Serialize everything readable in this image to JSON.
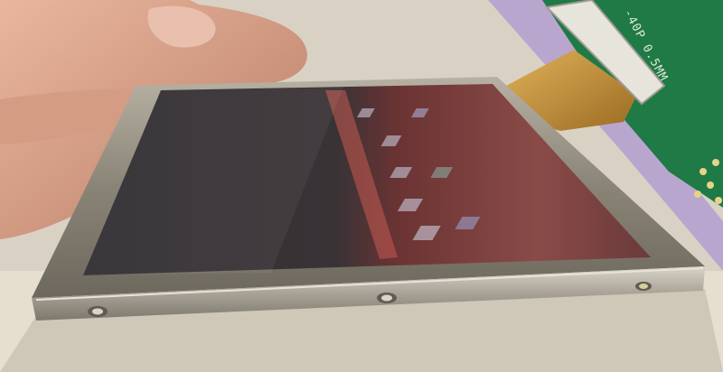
{
  "photo": {
    "subject": "",
    "pcb_silkscreen": "-40P 0.5MM"
  },
  "colors": {
    "background_wall": "#d9d2c4",
    "table_surface": "#e6dfcf",
    "metal_bezel": "#8a8476",
    "metal_bezel_light": "#bdb7a9",
    "screen_dark": "#2c2a2c",
    "screen_reddish": "#6c3434",
    "pcb_green": "#1f7a45",
    "flex_cable_amber": "#c9953a",
    "ribbon_lavender": "#b9a6cf",
    "skin": "#d8a38a"
  },
  "icons": [
    "screw-icon",
    "screw-icon",
    "screw-icon"
  ]
}
